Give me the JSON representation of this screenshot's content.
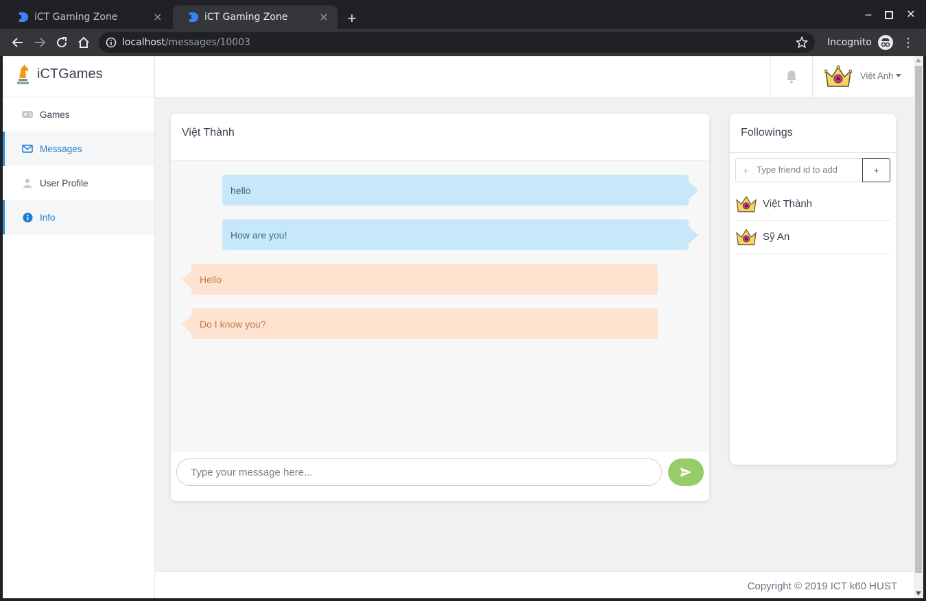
{
  "browser": {
    "tabs": [
      {
        "title": "iCT Gaming Zone",
        "active": false
      },
      {
        "title": "iCT Gaming Zone",
        "active": true
      }
    ],
    "new_tab": "+",
    "url_host": "localhost",
    "url_path": "/messages/10003",
    "incognito_label": "Incognito"
  },
  "sidebar": {
    "brand": "iCTGames",
    "items": [
      {
        "label": "Games",
        "icon": "gamepad-icon"
      },
      {
        "label": "Messages",
        "icon": "envelope-icon"
      },
      {
        "label": "User Profile",
        "icon": "user-icon"
      },
      {
        "label": "Info",
        "icon": "info-icon"
      }
    ]
  },
  "header": {
    "user_name": "Việt Anh"
  },
  "chat": {
    "title": "Việt Thành",
    "messages": [
      {
        "text": "hello",
        "direction": "outgoing"
      },
      {
        "text": "How are you!",
        "direction": "outgoing"
      },
      {
        "text": "Hello",
        "direction": "incoming"
      },
      {
        "text": "Do I know you?",
        "direction": "incoming"
      }
    ],
    "input_placeholder": "Type your message here..."
  },
  "followings": {
    "title": "Followings",
    "add_placeholder": "Type friend id to add",
    "add_button": "+",
    "friends": [
      {
        "name": "Việt Thành"
      },
      {
        "name": "Sỹ An"
      }
    ]
  },
  "footer": {
    "copyright": "Copyright © 2019 ICT k60 HUST"
  },
  "colors": {
    "accent": "#2c8fdb",
    "outgoing_bubble": "#c7e8f8",
    "incoming_bubble": "#fde3d0",
    "send_button": "#98cc6a"
  }
}
